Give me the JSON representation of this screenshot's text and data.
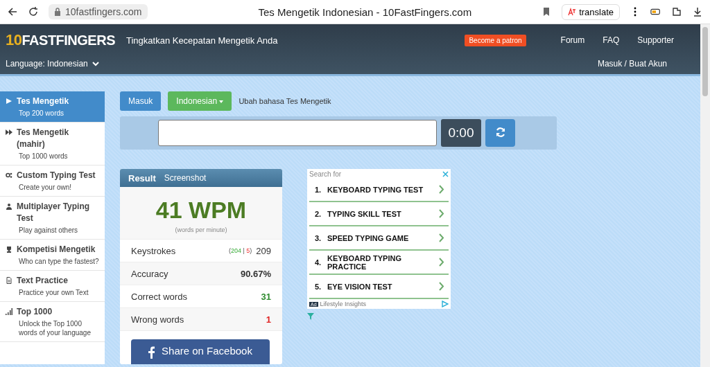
{
  "browser": {
    "url": "10fastfingers.com",
    "title": "Tes Mengetik Indonesian - 10FastFingers.com",
    "translate": "translate"
  },
  "header": {
    "logo_prefix": "10",
    "logo": "FASTFINGERS",
    "tagline": "Tingkatkan Kecepatan Mengetik Anda",
    "patron": "Become a patron",
    "nav": [
      "Forum",
      "FAQ",
      "Supporter"
    ],
    "language": "Language: Indonesian",
    "login": "Masuk / Buat Akun"
  },
  "sidebar": {
    "items": [
      {
        "title": "Tes Mengetik",
        "subtitle": "Top 200 words",
        "selected": true
      },
      {
        "title": "Tes Mengetik (mahir)",
        "subtitle": "Top 1000 words",
        "selected": false
      },
      {
        "title": "Custom Typing Test",
        "subtitle": "Create your own!",
        "selected": false
      },
      {
        "title": "Multiplayer Typing Test",
        "subtitle": "Play against others",
        "selected": false
      },
      {
        "title": "Kompetisi Mengetik",
        "subtitle": "Who can type the fastest?",
        "selected": false
      },
      {
        "title": "Text Practice",
        "subtitle": "Practice your own Text",
        "selected": false
      },
      {
        "title": "Top 1000",
        "subtitle": "Unlock the Top 1000 words of your language",
        "selected": false
      }
    ]
  },
  "toolbar": {
    "login_button": "Masuk",
    "language_button": "Indonesian",
    "language_hint": "Ubah bahasa Tes Mengetik"
  },
  "typing": {
    "timer": "0:00"
  },
  "result": {
    "tabs": [
      {
        "label": "Result",
        "selected": true
      },
      {
        "label": "Screenshot",
        "selected": false
      }
    ],
    "wpm": "41 WPM",
    "wpm_caption": "(words per minute)",
    "rows": [
      {
        "label": "Keystrokes",
        "breakdown": {
          "open": "(",
          "correct": "204",
          "separator": "|",
          "wrong": "5",
          "close": ")"
        },
        "value": "209",
        "color": "#333333"
      },
      {
        "label": "Accuracy",
        "value": "90.67%",
        "color": "#333333"
      },
      {
        "label": "Correct words",
        "value": "31",
        "color": "#2e8b2e"
      },
      {
        "label": "Wrong words",
        "value": "1",
        "color": "#e02020"
      }
    ],
    "share": "Share on Facebook"
  },
  "ad": {
    "heading": "Search for",
    "items": [
      {
        "number": "1.",
        "text": "KEYBOARD TYPING TEST"
      },
      {
        "number": "2.",
        "text": "TYPING SKILL TEST"
      },
      {
        "number": "3.",
        "text": "SPEED TYPING GAME"
      },
      {
        "number": "4.",
        "text": "KEYBOARD TYPING PRACTICE"
      },
      {
        "number": "5.",
        "text": "EYE VISION TEST"
      }
    ],
    "badge": "Ad",
    "sponsor": "Lifestyle Insights"
  }
}
